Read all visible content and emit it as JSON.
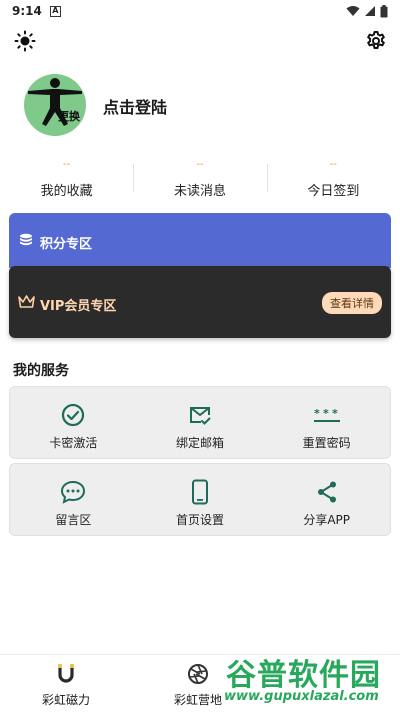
{
  "status_bar": {
    "time": "9:14",
    "badge": "A"
  },
  "profile": {
    "login_text": "点击登陆",
    "avatar_badge": "更换"
  },
  "stats": [
    {
      "value": "--",
      "label": "我的收藏"
    },
    {
      "value": "--",
      "label": "未读消息"
    },
    {
      "value": "--",
      "label": "今日签到"
    }
  ],
  "points_zone": {
    "label": "积分专区",
    "icon": "coins-icon",
    "color": "#5569d2"
  },
  "vip_zone": {
    "label": "VIP会员专区",
    "icon": "crown-icon",
    "button": "查看详情",
    "color": "#2b2b2b"
  },
  "services": {
    "title": "我的服务",
    "row1": [
      {
        "label": "卡密激活",
        "icon": "check-circle-icon"
      },
      {
        "label": "绑定邮箱",
        "icon": "mail-check-icon"
      },
      {
        "label": "重置密码",
        "icon": "password-icon"
      }
    ],
    "row2": [
      {
        "label": "留言区",
        "icon": "chat-icon"
      },
      {
        "label": "首页设置",
        "icon": "phone-icon"
      },
      {
        "label": "分享APP",
        "icon": "share-icon"
      }
    ],
    "accent": "#1f6b5a"
  },
  "bottom_nav": [
    {
      "label": "彩虹磁力",
      "icon": "magnet-icon"
    },
    {
      "label": "彩虹营地",
      "icon": "aperture-icon"
    }
  ],
  "watermark": {
    "text": "谷普软件园",
    "url": "www.gupuxlazal.com"
  }
}
